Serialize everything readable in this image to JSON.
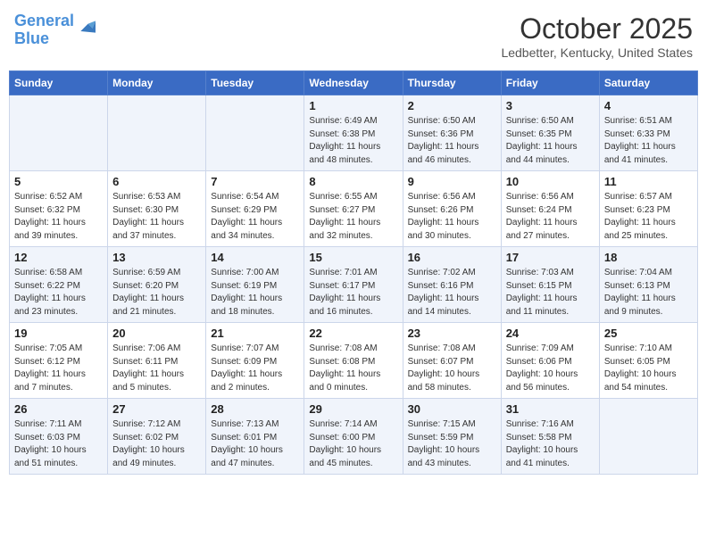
{
  "header": {
    "logo_line1": "General",
    "logo_line2": "Blue",
    "month": "October 2025",
    "location": "Ledbetter, Kentucky, United States"
  },
  "days_of_week": [
    "Sunday",
    "Monday",
    "Tuesday",
    "Wednesday",
    "Thursday",
    "Friday",
    "Saturday"
  ],
  "weeks": [
    [
      {
        "day": "",
        "info": ""
      },
      {
        "day": "",
        "info": ""
      },
      {
        "day": "",
        "info": ""
      },
      {
        "day": "1",
        "info": "Sunrise: 6:49 AM\nSunset: 6:38 PM\nDaylight: 11 hours\nand 48 minutes."
      },
      {
        "day": "2",
        "info": "Sunrise: 6:50 AM\nSunset: 6:36 PM\nDaylight: 11 hours\nand 46 minutes."
      },
      {
        "day": "3",
        "info": "Sunrise: 6:50 AM\nSunset: 6:35 PM\nDaylight: 11 hours\nand 44 minutes."
      },
      {
        "day": "4",
        "info": "Sunrise: 6:51 AM\nSunset: 6:33 PM\nDaylight: 11 hours\nand 41 minutes."
      }
    ],
    [
      {
        "day": "5",
        "info": "Sunrise: 6:52 AM\nSunset: 6:32 PM\nDaylight: 11 hours\nand 39 minutes."
      },
      {
        "day": "6",
        "info": "Sunrise: 6:53 AM\nSunset: 6:30 PM\nDaylight: 11 hours\nand 37 minutes."
      },
      {
        "day": "7",
        "info": "Sunrise: 6:54 AM\nSunset: 6:29 PM\nDaylight: 11 hours\nand 34 minutes."
      },
      {
        "day": "8",
        "info": "Sunrise: 6:55 AM\nSunset: 6:27 PM\nDaylight: 11 hours\nand 32 minutes."
      },
      {
        "day": "9",
        "info": "Sunrise: 6:56 AM\nSunset: 6:26 PM\nDaylight: 11 hours\nand 30 minutes."
      },
      {
        "day": "10",
        "info": "Sunrise: 6:56 AM\nSunset: 6:24 PM\nDaylight: 11 hours\nand 27 minutes."
      },
      {
        "day": "11",
        "info": "Sunrise: 6:57 AM\nSunset: 6:23 PM\nDaylight: 11 hours\nand 25 minutes."
      }
    ],
    [
      {
        "day": "12",
        "info": "Sunrise: 6:58 AM\nSunset: 6:22 PM\nDaylight: 11 hours\nand 23 minutes."
      },
      {
        "day": "13",
        "info": "Sunrise: 6:59 AM\nSunset: 6:20 PM\nDaylight: 11 hours\nand 21 minutes."
      },
      {
        "day": "14",
        "info": "Sunrise: 7:00 AM\nSunset: 6:19 PM\nDaylight: 11 hours\nand 18 minutes."
      },
      {
        "day": "15",
        "info": "Sunrise: 7:01 AM\nSunset: 6:17 PM\nDaylight: 11 hours\nand 16 minutes."
      },
      {
        "day": "16",
        "info": "Sunrise: 7:02 AM\nSunset: 6:16 PM\nDaylight: 11 hours\nand 14 minutes."
      },
      {
        "day": "17",
        "info": "Sunrise: 7:03 AM\nSunset: 6:15 PM\nDaylight: 11 hours\nand 11 minutes."
      },
      {
        "day": "18",
        "info": "Sunrise: 7:04 AM\nSunset: 6:13 PM\nDaylight: 11 hours\nand 9 minutes."
      }
    ],
    [
      {
        "day": "19",
        "info": "Sunrise: 7:05 AM\nSunset: 6:12 PM\nDaylight: 11 hours\nand 7 minutes."
      },
      {
        "day": "20",
        "info": "Sunrise: 7:06 AM\nSunset: 6:11 PM\nDaylight: 11 hours\nand 5 minutes."
      },
      {
        "day": "21",
        "info": "Sunrise: 7:07 AM\nSunset: 6:09 PM\nDaylight: 11 hours\nand 2 minutes."
      },
      {
        "day": "22",
        "info": "Sunrise: 7:08 AM\nSunset: 6:08 PM\nDaylight: 11 hours\nand 0 minutes."
      },
      {
        "day": "23",
        "info": "Sunrise: 7:08 AM\nSunset: 6:07 PM\nDaylight: 10 hours\nand 58 minutes."
      },
      {
        "day": "24",
        "info": "Sunrise: 7:09 AM\nSunset: 6:06 PM\nDaylight: 10 hours\nand 56 minutes."
      },
      {
        "day": "25",
        "info": "Sunrise: 7:10 AM\nSunset: 6:05 PM\nDaylight: 10 hours\nand 54 minutes."
      }
    ],
    [
      {
        "day": "26",
        "info": "Sunrise: 7:11 AM\nSunset: 6:03 PM\nDaylight: 10 hours\nand 51 minutes."
      },
      {
        "day": "27",
        "info": "Sunrise: 7:12 AM\nSunset: 6:02 PM\nDaylight: 10 hours\nand 49 minutes."
      },
      {
        "day": "28",
        "info": "Sunrise: 7:13 AM\nSunset: 6:01 PM\nDaylight: 10 hours\nand 47 minutes."
      },
      {
        "day": "29",
        "info": "Sunrise: 7:14 AM\nSunset: 6:00 PM\nDaylight: 10 hours\nand 45 minutes."
      },
      {
        "day": "30",
        "info": "Sunrise: 7:15 AM\nSunset: 5:59 PM\nDaylight: 10 hours\nand 43 minutes."
      },
      {
        "day": "31",
        "info": "Sunrise: 7:16 AM\nSunset: 5:58 PM\nDaylight: 10 hours\nand 41 minutes."
      },
      {
        "day": "",
        "info": ""
      }
    ]
  ]
}
